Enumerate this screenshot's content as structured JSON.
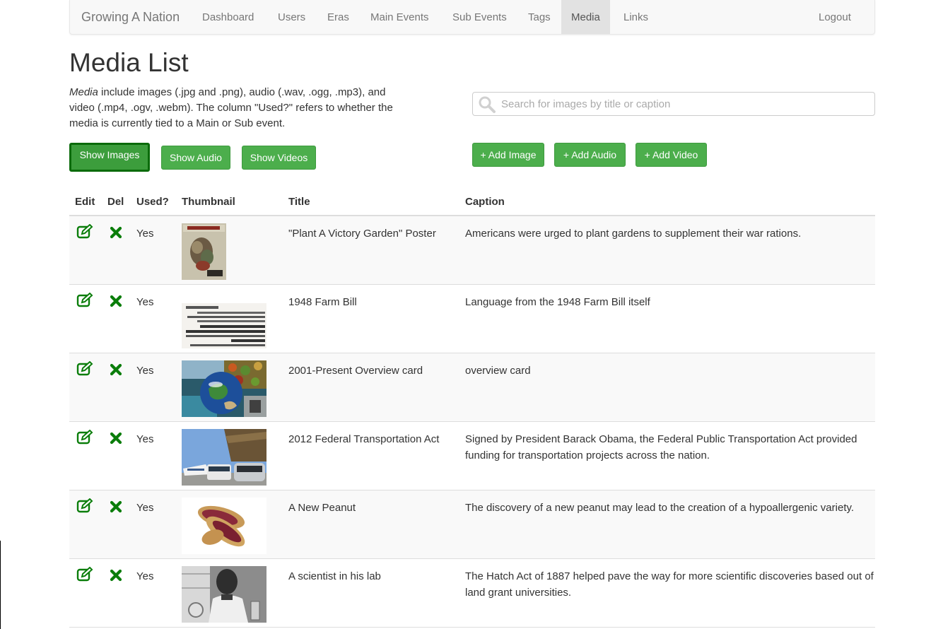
{
  "colors": {
    "accent_green": "#4cae4c",
    "icon_green": "#0a7d0a",
    "nav_bg": "#f8f8f8"
  },
  "navbar": {
    "brand": "Growing A Nation",
    "items": [
      "Dashboard",
      "Users",
      "Eras",
      "Main Events",
      "Sub Events",
      "Tags",
      "Media",
      "Links"
    ],
    "active": "Media",
    "logout": "Logout"
  },
  "page": {
    "title": "Media List",
    "intro_em": "Media",
    "intro_rest": " include images (.jpg and .png), audio (.wav, .ogg, .mp3), and video (.mp4, .ogv, .webm). The column \"Used?\" refers to whether the media is currently tied to a Main or Sub event."
  },
  "search": {
    "placeholder": "Search for images by title or caption",
    "icon": "search-icon"
  },
  "filters": {
    "show_images": "Show Images",
    "show_audio": "Show Audio",
    "show_videos": "Show Videos",
    "selected": "Show Images"
  },
  "add_buttons": {
    "image": "+ Add Image",
    "audio": "+ Add Audio",
    "video": "+ Add Video"
  },
  "table": {
    "headers": {
      "edit": "Edit",
      "del": "Del",
      "used": "Used?",
      "thumbnail": "Thumbnail",
      "title": "Title",
      "caption": "Caption"
    },
    "icons": {
      "edit": "edit-icon",
      "del": "delete-x-icon"
    },
    "rows": [
      {
        "used": "Yes",
        "title": "\"Plant A Victory Garden\" Poster",
        "caption": "Americans were urged to plant gardens to supplement their war rations.",
        "thumb": "victory-garden-poster"
      },
      {
        "used": "Yes",
        "title": "1948 Farm Bill",
        "caption": "Language from the 1948 Farm Bill itself",
        "thumb": "farm-bill-document"
      },
      {
        "used": "Yes",
        "title": "2001-Present Overview card",
        "caption": "overview card",
        "thumb": "overview-collage"
      },
      {
        "used": "Yes",
        "title": "2012 Federal Transportation Act",
        "caption": "Signed by President Barack Obama, the Federal Public Transportation Act provided funding for transportation projects across the nation.",
        "thumb": "transportation-photo"
      },
      {
        "used": "Yes",
        "title": "A New Peanut",
        "caption": "The discovery of a new peanut may lead to the creation of a hypoallergenic variety.",
        "thumb": "peanut-photo"
      },
      {
        "used": "Yes",
        "title": "A scientist in his lab",
        "caption": "The Hatch Act of 1887 helped pave the way for more scientific discoveries based out of land grant universities.",
        "thumb": "scientist-photo"
      }
    ]
  }
}
